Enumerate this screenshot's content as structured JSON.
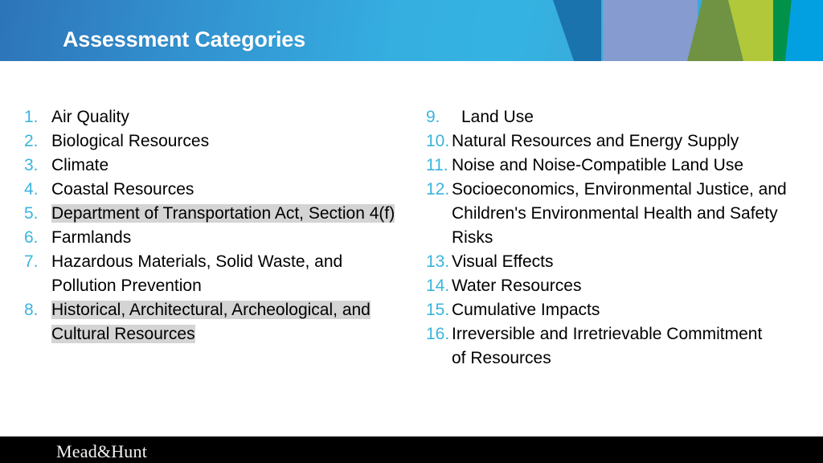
{
  "header": {
    "title": "Assessment Categories",
    "gradient_from": "#2d74b8",
    "gradient_to": "#39a8d8",
    "shapes": [
      {
        "name": "dark-blue-trapezoid",
        "color": "#1a73ad"
      },
      {
        "name": "periwinkle-block",
        "color": "#869bcf"
      },
      {
        "name": "olive-green-triangle",
        "color": "#6f9243"
      },
      {
        "name": "yellow-green-block",
        "color": "#b0c83a"
      },
      {
        "name": "dark-green-block",
        "color": "#029149"
      },
      {
        "name": "cyan-blue-block",
        "color": "#02a0e0"
      }
    ]
  },
  "list": {
    "number_color": "#3bb4dc",
    "highlight_color": "#d4d4d4",
    "left_column": [
      {
        "number": "1.",
        "lines": [
          "Air Quality"
        ],
        "highlighted": false
      },
      {
        "number": "2.",
        "lines": [
          "Biological Resources"
        ],
        "highlighted": false
      },
      {
        "number": "3.",
        "lines": [
          "Climate"
        ],
        "highlighted": false
      },
      {
        "number": "4.",
        "lines": [
          "Coastal Resources"
        ],
        "highlighted": false
      },
      {
        "number": "5.",
        "lines": [
          "Department of Transportation Act, Section 4(f)"
        ],
        "highlighted": true
      },
      {
        "number": "6.",
        "lines": [
          "Farmlands"
        ],
        "highlighted": false
      },
      {
        "number": "7.",
        "lines": [
          "Hazardous Materials, Solid Waste, and",
          "Pollution Prevention"
        ],
        "highlighted": false
      },
      {
        "number": "8.",
        "lines": [
          "Historical, Architectural, Archeological, and",
          "Cultural Resources"
        ],
        "highlighted": true
      }
    ],
    "right_column": [
      {
        "number": "9.",
        "lines": [
          "Land Use"
        ],
        "highlighted": false,
        "extra_indent": true
      },
      {
        "number": "10.",
        "lines": [
          "Natural Resources and Energy Supply"
        ],
        "highlighted": false
      },
      {
        "number": "11.",
        "lines": [
          "Noise and Noise-Compatible Land Use"
        ],
        "highlighted": false
      },
      {
        "number": "12.",
        "lines": [
          "Socioeconomics, Environmental Justice, and",
          "Children's Environmental Health and Safety",
          "Risks"
        ],
        "highlighted": false
      },
      {
        "number": "13.",
        "lines": [
          "Visual Effects"
        ],
        "highlighted": false
      },
      {
        "number": "14.",
        "lines": [
          "Water Resources"
        ],
        "highlighted": false
      },
      {
        "number": "15.",
        "lines": [
          "Cumulative Impacts"
        ],
        "highlighted": false
      },
      {
        "number": "16.",
        "lines": [
          "Irreversible and Irretrievable Commitment",
          "of Resources"
        ],
        "highlighted": false
      }
    ]
  },
  "footer": {
    "logo_text": "Mead&Hunt",
    "background": "#000000"
  }
}
